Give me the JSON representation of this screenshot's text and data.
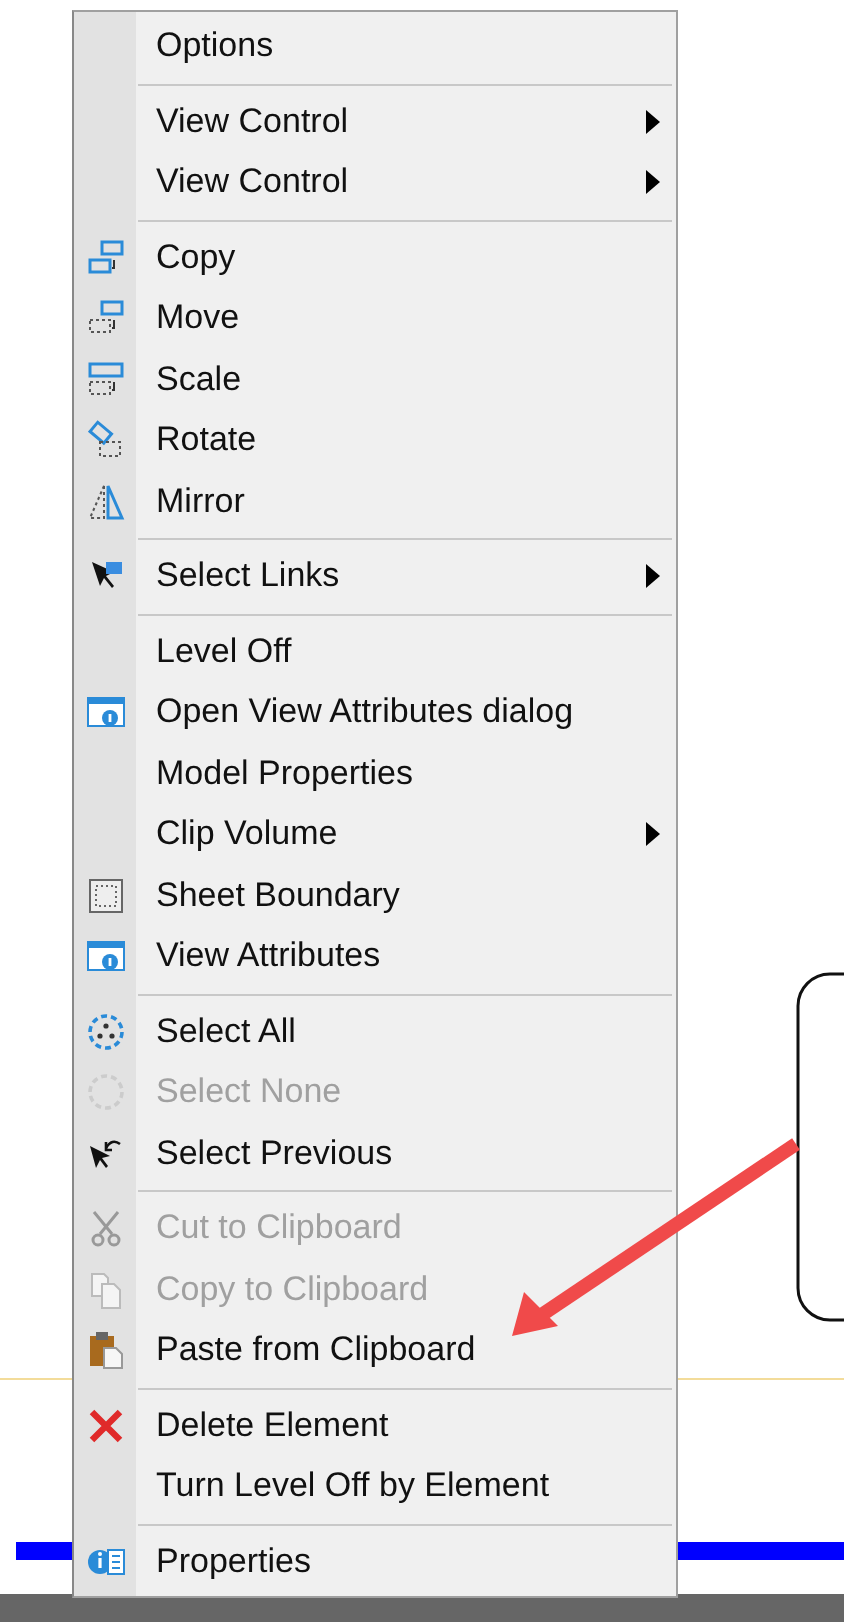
{
  "menu": {
    "items": [
      {
        "kind": "header",
        "label": "Options"
      },
      {
        "kind": "separator"
      },
      {
        "kind": "item",
        "label": "View Control",
        "disabled": false,
        "submenu": true
      },
      {
        "kind": "item",
        "label": "View Control",
        "disabled": false,
        "submenu": true
      },
      {
        "kind": "separator"
      },
      {
        "kind": "item",
        "label": "Copy",
        "disabled": false,
        "submenu": false
      },
      {
        "kind": "item",
        "label": "Move",
        "disabled": false,
        "submenu": false
      },
      {
        "kind": "item",
        "label": "Scale",
        "disabled": false,
        "submenu": false
      },
      {
        "kind": "item",
        "label": "Rotate",
        "disabled": false,
        "submenu": false
      },
      {
        "kind": "item",
        "label": "Mirror",
        "disabled": false,
        "submenu": false
      },
      {
        "kind": "separator"
      },
      {
        "kind": "item",
        "label": "Select Links",
        "disabled": false,
        "submenu": true
      },
      {
        "kind": "separator"
      },
      {
        "kind": "item",
        "label": "Level Off",
        "disabled": false,
        "submenu": false
      },
      {
        "kind": "item",
        "label": "Open View Attributes dialog",
        "disabled": false,
        "submenu": false
      },
      {
        "kind": "item",
        "label": "Model Properties",
        "disabled": false,
        "submenu": false
      },
      {
        "kind": "item",
        "label": "Clip Volume",
        "disabled": false,
        "submenu": true
      },
      {
        "kind": "item",
        "label": "Sheet Boundary",
        "disabled": false,
        "submenu": false
      },
      {
        "kind": "item",
        "label": "View Attributes",
        "disabled": false,
        "submenu": false
      },
      {
        "kind": "separator"
      },
      {
        "kind": "item",
        "label": "Select All",
        "disabled": false,
        "submenu": false
      },
      {
        "kind": "item",
        "label": "Select None",
        "disabled": true,
        "submenu": false
      },
      {
        "kind": "item",
        "label": "Select Previous",
        "disabled": false,
        "submenu": false
      },
      {
        "kind": "separator"
      },
      {
        "kind": "item",
        "label": "Cut to Clipboard",
        "disabled": true,
        "submenu": false
      },
      {
        "kind": "item",
        "label": "Copy to Clipboard",
        "disabled": true,
        "submenu": false
      },
      {
        "kind": "item",
        "label": "Paste from Clipboard",
        "disabled": false,
        "submenu": false
      },
      {
        "kind": "separator"
      },
      {
        "kind": "item",
        "label": "Delete Element",
        "disabled": false,
        "submenu": false
      },
      {
        "kind": "item",
        "label": "Turn Level Off by Element",
        "disabled": false,
        "submenu": false
      },
      {
        "kind": "separator"
      },
      {
        "kind": "item",
        "label": "Properties",
        "disabled": false,
        "submenu": false
      }
    ]
  }
}
